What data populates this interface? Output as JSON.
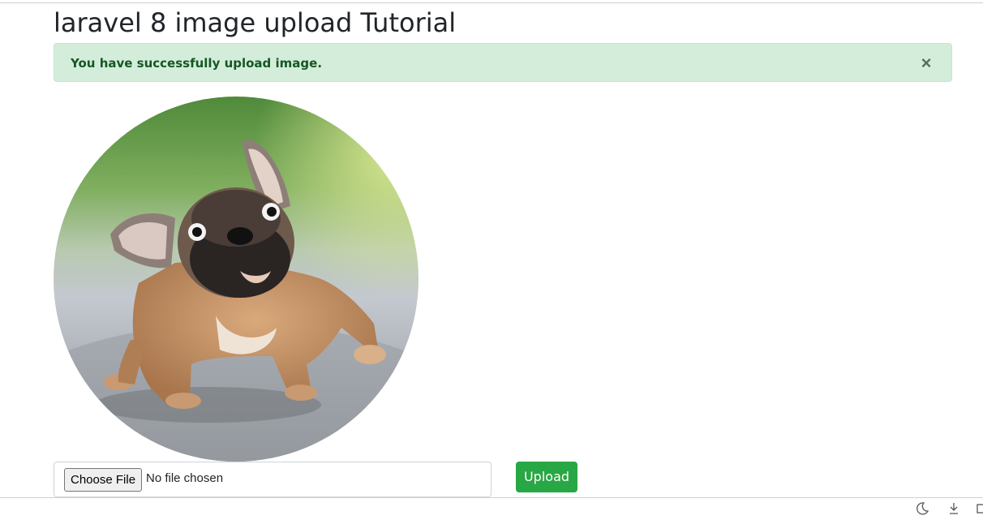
{
  "page": {
    "title": "laravel 8 image upload Tutorial"
  },
  "alert": {
    "message": "You have successfully upload image.",
    "close_glyph": "×",
    "type": "success",
    "background": "#d4edda",
    "text_color": "#155724"
  },
  "image": {
    "alt": "french bulldog puppy",
    "shape": "circle"
  },
  "form": {
    "choose_file_label": "Choose File",
    "file_status": "No file chosen",
    "upload_label": "Upload",
    "upload_color": "#28a745"
  },
  "status_bar": {
    "icons": [
      "moon-icon",
      "download-icon",
      "panel-icon"
    ]
  }
}
